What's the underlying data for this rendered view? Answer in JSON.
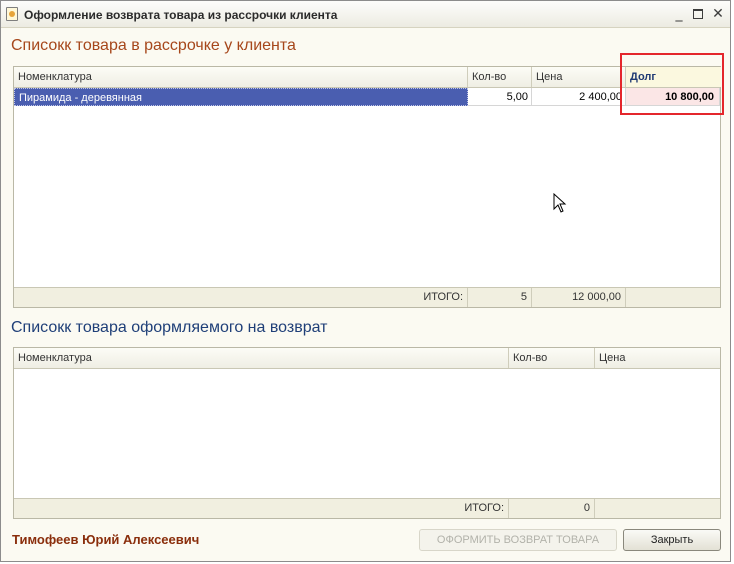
{
  "window": {
    "title": "Оформление возврата товара из рассрочки клиента"
  },
  "icons": {
    "app": "app-form-icon",
    "minimize": "minimize-icon",
    "maximize": "maximize-icon",
    "close": "close-icon",
    "cursor": "mouse-pointer-icon"
  },
  "installment_section": {
    "title": "Списокк товара  в рассрочке у клиента",
    "columns": {
      "name": "Номенклатура",
      "qty": "Кол-во",
      "price": "Цена",
      "debt": "Долг"
    },
    "rows": [
      {
        "name": "Пирамида - деревянная",
        "qty": "5,00",
        "price": "2 400,00",
        "debt": "10 800,00"
      }
    ],
    "totals": {
      "label": "ИТОГО:",
      "qty": "5",
      "price": "12 000,00",
      "debt": ""
    }
  },
  "return_section": {
    "title": "Списокк товара  оформляемого на возврат",
    "columns": {
      "name": "Номенклатура",
      "qty": "Кол-во",
      "price": "Цена"
    },
    "rows": [],
    "totals": {
      "label": "ИТОГО:",
      "qty": "0",
      "price": ""
    }
  },
  "footer": {
    "user_name": "Тимофеев Юрий Алексеевич",
    "return_button": "ОФОРМИТЬ ВОЗВРАТ ТОВАРА",
    "close_button": "Закрыть"
  },
  "colors": {
    "selected_row": "#4a5eb0",
    "highlight_box": "#e4262c",
    "section1_title": "#a6471b",
    "section2_title": "#1f3f78",
    "user_name": "#8a2e0c"
  }
}
